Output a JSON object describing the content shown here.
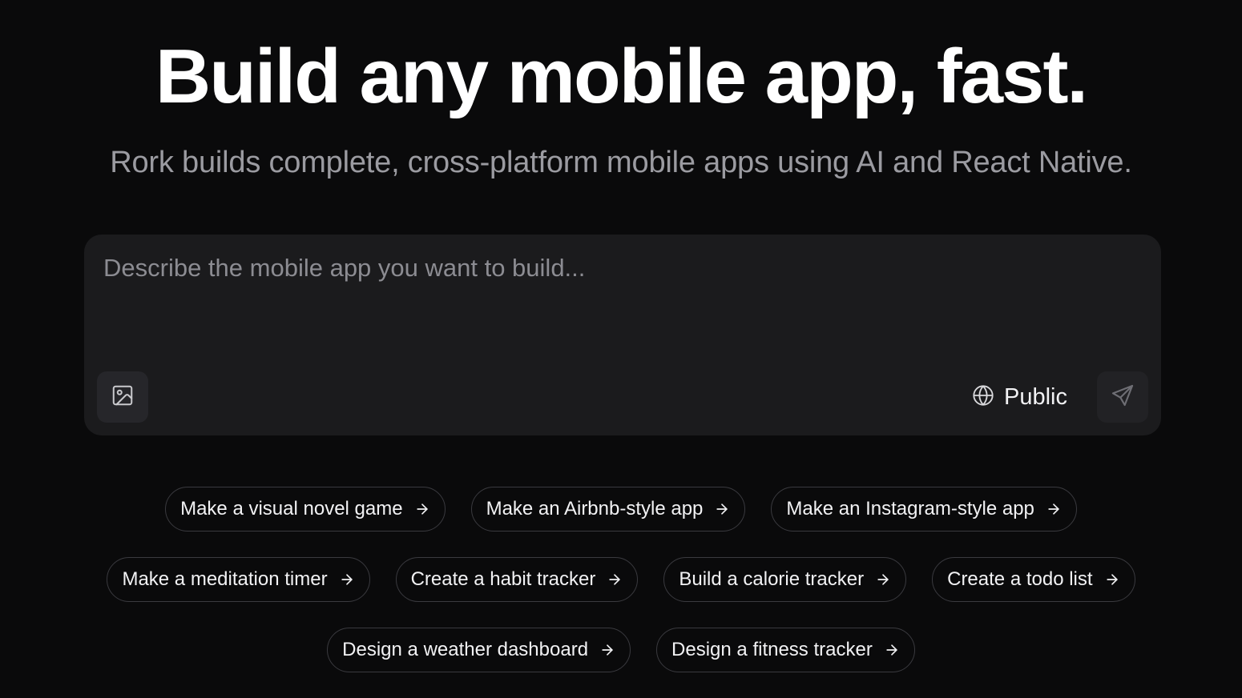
{
  "hero": {
    "headline": "Build any mobile app, fast.",
    "subheadline": "Rork builds complete, cross-platform mobile apps using AI and React Native."
  },
  "prompt": {
    "placeholder": "Describe the mobile app you want to build...",
    "value": "",
    "image_icon": "image-icon",
    "visibility_icon": "globe-icon",
    "visibility_label": "Public",
    "send_icon": "send-icon"
  },
  "suggestions": {
    "row1": [
      {
        "label": "Make a visual novel game"
      },
      {
        "label": "Make an Airbnb-style app"
      },
      {
        "label": "Make an Instagram-style app"
      }
    ],
    "row2": [
      {
        "label": "Make a meditation timer"
      },
      {
        "label": "Create a habit tracker"
      },
      {
        "label": "Build a calorie tracker"
      },
      {
        "label": "Create a todo list"
      }
    ],
    "row3": [
      {
        "label": "Design a weather dashboard"
      },
      {
        "label": "Design a fitness tracker"
      }
    ],
    "chip_icon": "arrow-right-icon"
  },
  "colors": {
    "background": "#0a0a0b",
    "panel": "#1b1b1d",
    "muted_text": "#9b9ba1",
    "chip_border": "#3a3a3f"
  }
}
